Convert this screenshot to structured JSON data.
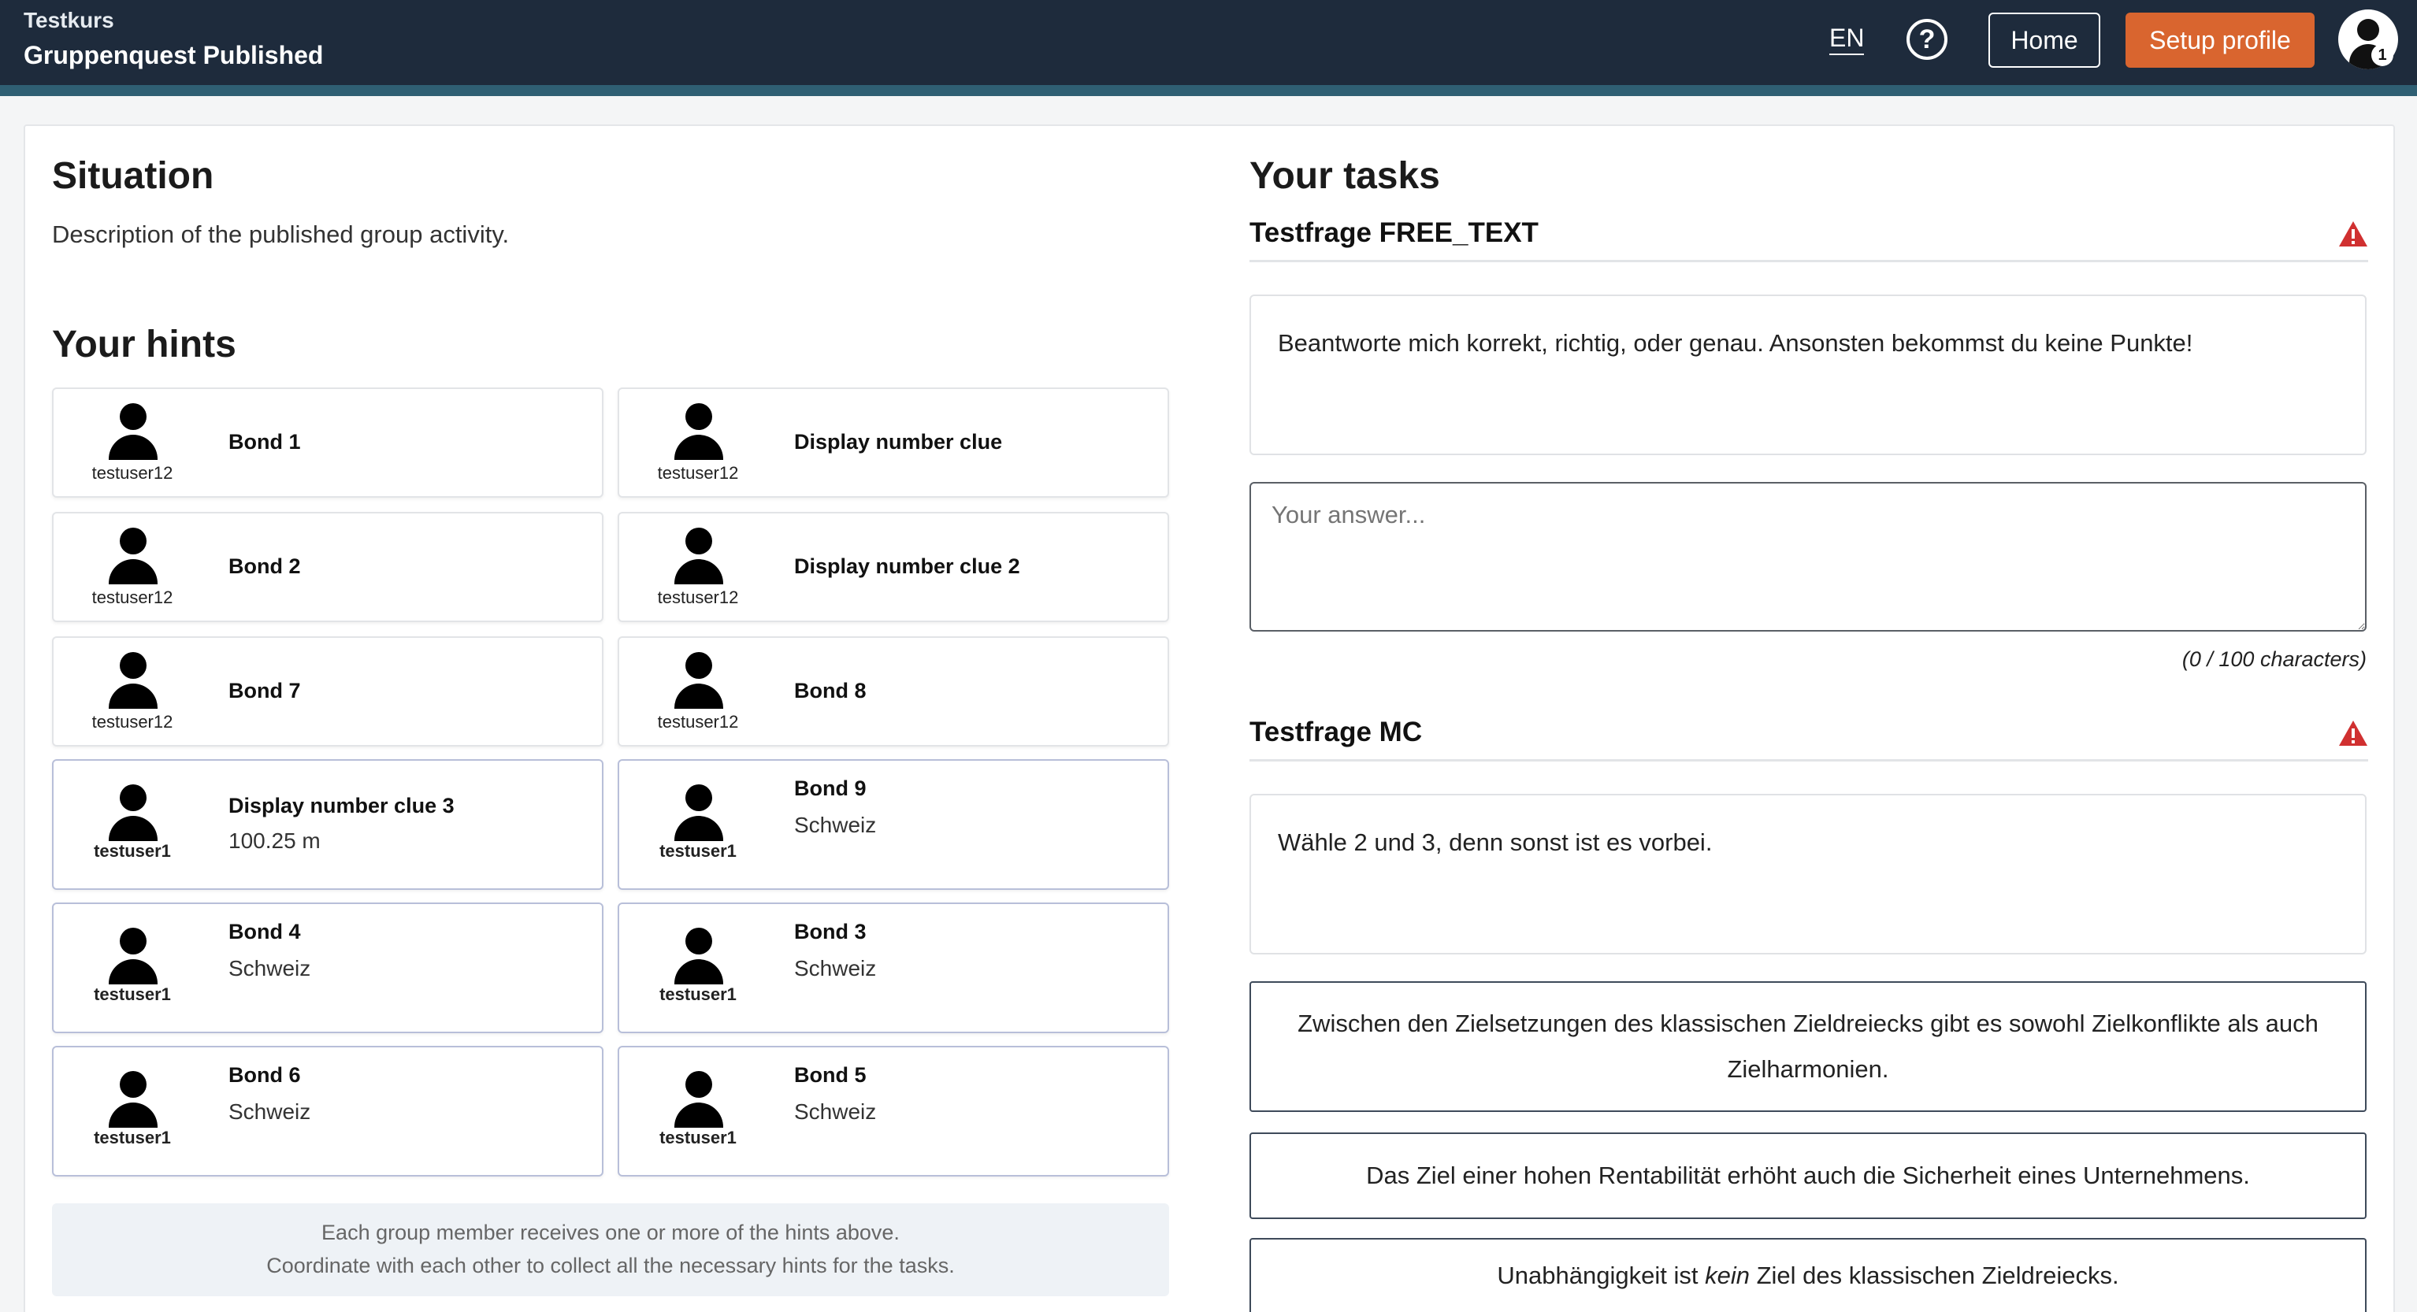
{
  "header": {
    "course": "Testkurs",
    "quest_title": "Gruppenquest Published",
    "language": "EN",
    "help_label": "?",
    "home_label": "Home",
    "setup_profile_label": "Setup profile",
    "avatar_badge": "1"
  },
  "situation": {
    "title": "Situation",
    "description": "Description of the published group activity."
  },
  "hints": {
    "title": "Your hints",
    "items": [
      {
        "user": "testuser12",
        "title": "Bond 1",
        "value": ""
      },
      {
        "user": "testuser12",
        "title": "Display number clue",
        "value": ""
      },
      {
        "user": "testuser12",
        "title": "Bond 2",
        "value": ""
      },
      {
        "user": "testuser12",
        "title": "Display number clue 2",
        "value": ""
      },
      {
        "user": "testuser12",
        "title": "Bond 7",
        "value": ""
      },
      {
        "user": "testuser12",
        "title": "Bond 8",
        "value": ""
      },
      {
        "user": "testuser1",
        "title": "Display number clue 3",
        "value": "100.25 m"
      },
      {
        "user": "testuser1",
        "title": "Bond 9",
        "value": "Schweiz"
      },
      {
        "user": "testuser1",
        "title": "Bond 4",
        "value": "Schweiz"
      },
      {
        "user": "testuser1",
        "title": "Bond 3",
        "value": "Schweiz"
      },
      {
        "user": "testuser1",
        "title": "Bond 6",
        "value": "Schweiz"
      },
      {
        "user": "testuser1",
        "title": "Bond 5",
        "value": "Schweiz"
      }
    ],
    "note_line1": "Each group member receives one or more of the hints above.",
    "note_line2": "Coordinate with each other to collect all the necessary hints for the tasks."
  },
  "tasks": {
    "title": "Your tasks",
    "free_text": {
      "heading": "Testfrage FREE_TEXT",
      "question": "Beantworte mich korrekt, richtig, oder genau. Ansonsten bekommst du keine Punkte!",
      "placeholder": "Your answer...",
      "char_count": "(0 / 100 characters)"
    },
    "mc": {
      "heading": "Testfrage MC",
      "question": "Wähle 2 und 3, denn sonst ist es vorbei.",
      "options": [
        "Zwischen den Zielsetzungen des klassischen Zieldreiecks gibt es sowohl Zielkonflikte als auch Zielharmonien.",
        "Das Ziel einer hohen Rentabilität erhöht auch die Sicherheit eines Unternehmens."
      ],
      "option3_before": "Unabhängigkeit ist ",
      "option3_emph": "kein",
      "option3_after": " Ziel des klassischen Zieldreiecks."
    }
  },
  "colors": {
    "header_bg": "#1e2b3c",
    "accent_orange": "#d9652f",
    "warning_red": "#d03030"
  }
}
